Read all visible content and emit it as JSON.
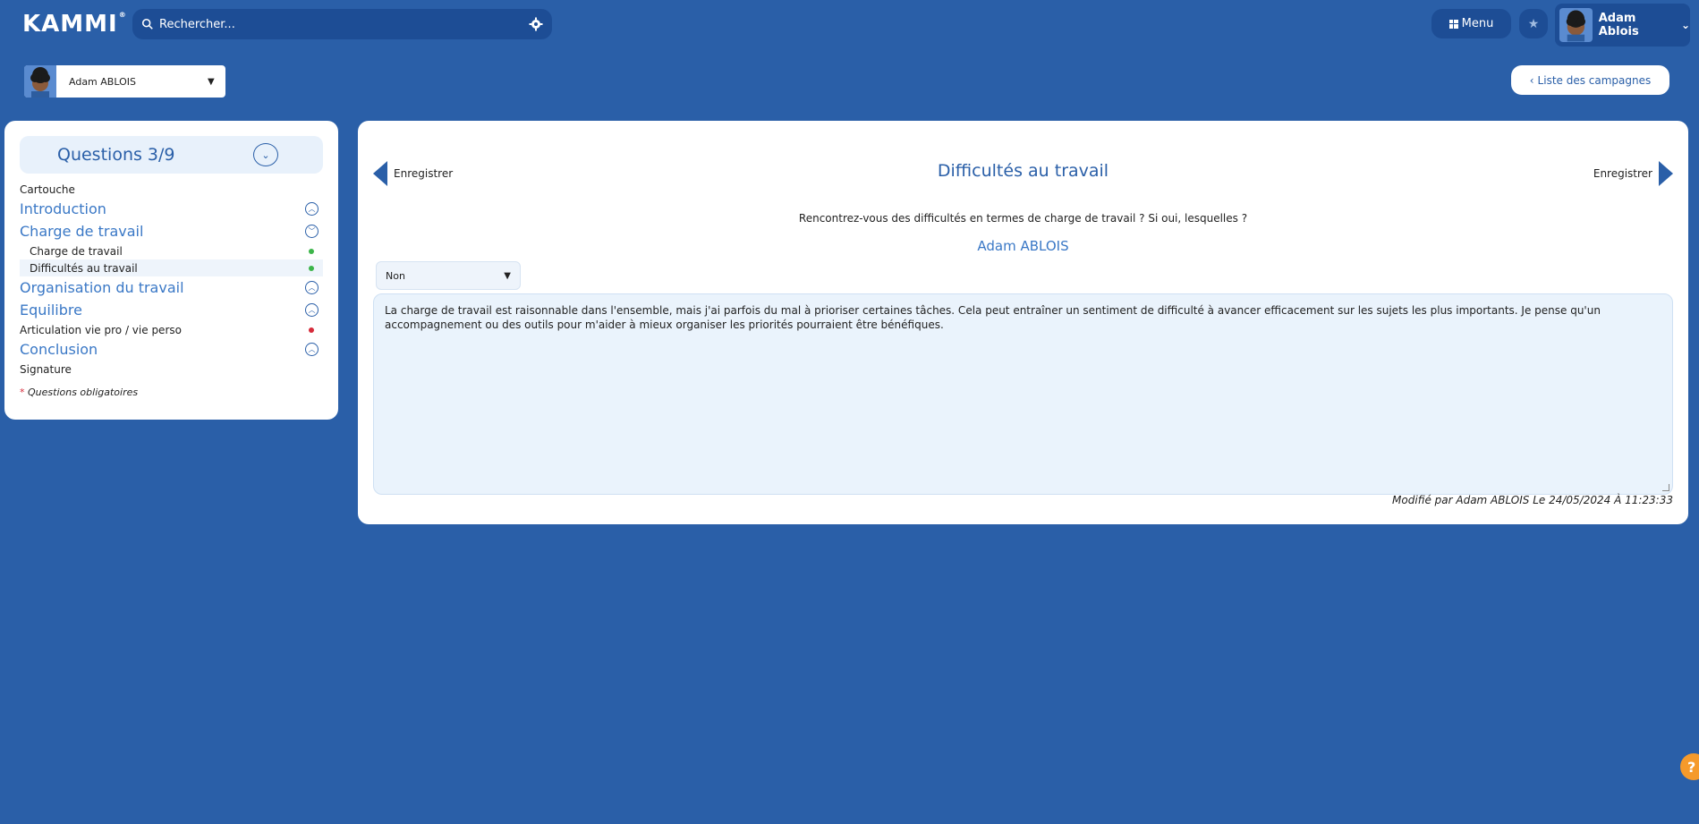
{
  "brand": {
    "logo": "KAMMI"
  },
  "search": {
    "placeholder": "Rechercher..."
  },
  "header": {
    "menu_label": "Menu",
    "user_name": "Adam Ablois"
  },
  "user_select": {
    "value": "Adam ABLOIS"
  },
  "campaign_button": {
    "label": "Liste des campagnes"
  },
  "sidebar": {
    "title": "Questions 3/9",
    "items": [
      {
        "kind": "small",
        "label": "Cartouche"
      },
      {
        "kind": "sec",
        "label": "Introduction",
        "toggle": "up"
      },
      {
        "kind": "sec",
        "label": "Charge de travail",
        "toggle": "down"
      },
      {
        "kind": "sub",
        "label": "Charge de travail",
        "status": "green"
      },
      {
        "kind": "sub",
        "label": "Difficultés au travail",
        "status": "green",
        "active": true
      },
      {
        "kind": "sec",
        "label": "Organisation du travail",
        "toggle": "up"
      },
      {
        "kind": "sec",
        "label": "Equilibre",
        "toggle": "up"
      },
      {
        "kind": "small",
        "label": "Articulation vie pro / vie perso",
        "status": "red"
      },
      {
        "kind": "sec",
        "label": "Conclusion",
        "toggle": "up"
      },
      {
        "kind": "small",
        "label": "Signature"
      }
    ],
    "legend_star": "*",
    "legend_text": "Questions obligatoires"
  },
  "main": {
    "prev_label": "Enregistrer",
    "next_label": "Enregistrer",
    "title": "Difficultés au travail",
    "question": "Rencontrez-vous des difficultés en termes de charge de travail ? Si oui, lesquelles ?",
    "author": "Adam ABLOIS",
    "select_value": "Non",
    "answer": "La charge de travail est raisonnable dans l'ensemble, mais j'ai parfois du mal à prioriser certaines tâches. Cela peut entraîner un sentiment de difficulté à avancer efficacement sur les sujets les plus importants. Je pense qu'un accompagnement ou des outils pour m'aider à mieux organiser les priorités pourraient être bénéfiques.",
    "modified": "Modifié par Adam ABLOIS Le 24/05/2024 À 11:23:33"
  },
  "colors": {
    "primary": "#2a5fa8",
    "dark": "#1d4d95",
    "green": "#3cb54a",
    "red": "#d62b3a",
    "help": "#f59a2b"
  },
  "help": {
    "label": "?"
  }
}
